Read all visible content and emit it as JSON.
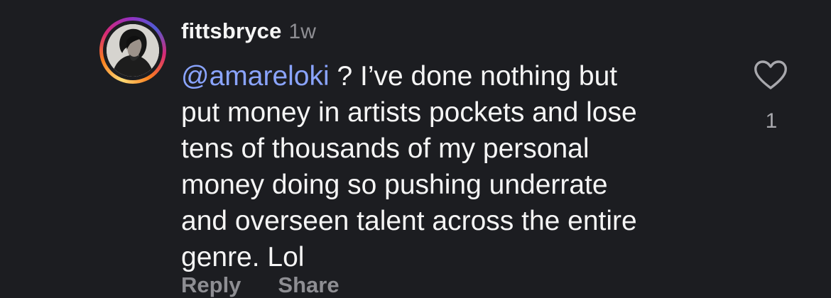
{
  "comment": {
    "username": "fittsbryce",
    "timestamp": "1w",
    "mention": "@amareloki",
    "body_lines": [
      " ? I’ve done nothing but",
      "put money in artists pockets and lose",
      "tens of thousands of my personal",
      "money doing so pushing underrate",
      "and overseen talent across the entire",
      "genre. Lol"
    ],
    "like_count": "1",
    "actions": {
      "reply_label": "Reply",
      "share_label": "Share"
    }
  },
  "icons": {
    "like": "heart-outline-icon",
    "avatar": "profile-photo"
  },
  "colors": {
    "background": "#1c1d21",
    "text": "#f5f5f5",
    "mention": "#8aa4ff",
    "muted": "#8e8e93",
    "story_ring": [
      "#feda75",
      "#fa7e1e",
      "#d62976",
      "#962fbf",
      "#4f5bd5"
    ]
  }
}
